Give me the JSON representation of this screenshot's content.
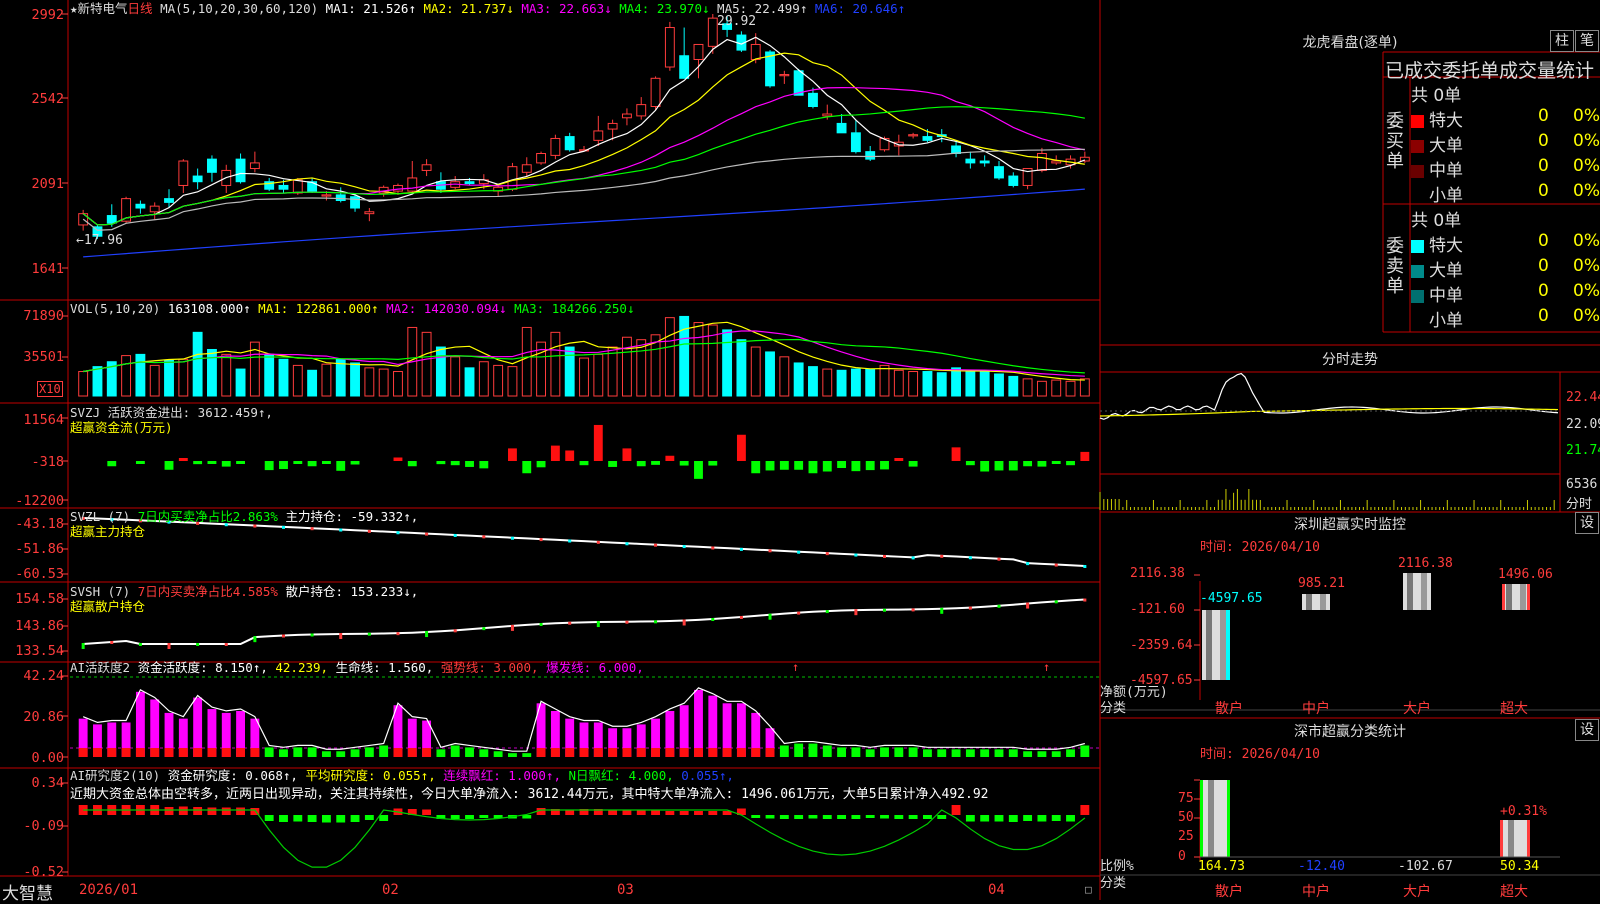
{
  "stock": {
    "star": "★",
    "name": "新特电气",
    "period": "日线",
    "ma_label": "MA(5,10,20,30,60,120)",
    "ma1": "MA1: 21.526↑",
    "ma2": "MA2: 21.737↓",
    "ma3": "MA3: 22.663↓",
    "ma4": "MA4: 23.970↓",
    "ma5": "MA5: 22.499↑",
    "ma6": "MA6: 20.646↑",
    "high_mark": "29.92",
    "low_mark": "←17.96"
  },
  "price_axis": [
    "2992",
    "2542",
    "2091",
    "1641"
  ],
  "vol": {
    "label": "VOL(5,10,20)",
    "value": "163108.000↑",
    "ma1": "MA1: 122861.000↑",
    "ma2": "MA2: 142030.094↓",
    "ma3": "MA3: 184266.250↓",
    "axis": [
      "71890",
      "35501"
    ],
    "unit": "X10"
  },
  "svzj": {
    "label": "SVZJ  活跃资金进出: 3612.459↑,",
    "sub": "超赢资金流(万元)",
    "axis": [
      "11564",
      "-318",
      "-12200"
    ]
  },
  "svzl": {
    "label": "SVZL (7)",
    "buy": "7日内买卖净占比2.863%",
    "hold": "主力持仓: -59.332↑,",
    "sub": "超赢主力持仓",
    "axis": [
      "-43.18",
      "-51.86",
      "-60.53"
    ]
  },
  "svsh": {
    "label": "SVSH (7)",
    "buy": "7日内买卖净占比4.585%",
    "hold": "散户持仓: 153.233↓,",
    "sub": "超赢散户持仓",
    "axis": [
      "154.58",
      "143.86",
      "133.54"
    ]
  },
  "ai1": {
    "label": "AI活跃度2",
    "act": "资金活跃度: 8.150↑,",
    "v": "42.239,",
    "life": "生命线: 1.560,",
    "strong": "强势线: 3.000,",
    "burst": "爆发线: 6.000,",
    "axis": [
      "42.24",
      "20.86",
      "0.00"
    ]
  },
  "ai2": {
    "label": "AI研究度2(10)",
    "res": "资金研究度: 0.068↑,",
    "avg": "平均研究度: 0.055↑,",
    "cont": "连续飘红: 1.000↑,",
    "nday": "N日飘红: 4.000,",
    "last": "0.055↑,",
    "desc": "近期大资金总体由空转多，近两日出现异动，关注其持续性，今日大单净流入: 3612.44万元，其中特大单净流入: 1496.061万元，大单5日累计净入492.92",
    "axis": [
      "0.34",
      "-0.09",
      "-0.52"
    ]
  },
  "dates": [
    "2026/01",
    "02",
    "03",
    "04"
  ],
  "brand": "大智慧",
  "dragon": {
    "title": "龙虎看盘(逐单)",
    "btn1": "柱",
    "btn2": "笔",
    "head": "已成交委托单成交量统计",
    "buy": {
      "label": "委买单",
      "total": "共 0单",
      "rows": [
        {
          "name": "特大",
          "v": "0",
          "p": "0%",
          "color": "#ff0000"
        },
        {
          "name": "大单",
          "v": "0",
          "p": "0%",
          "color": "#8b0000"
        },
        {
          "name": "中单",
          "v": "0",
          "p": "0%",
          "color": "#6a0000"
        },
        {
          "name": "小单",
          "v": "0",
          "p": "0%",
          "color": "#000000"
        }
      ]
    },
    "sell": {
      "label": "委卖单",
      "total": "共 0单",
      "rows": [
        {
          "name": "特大",
          "v": "0",
          "p": "0%",
          "color": "#00ffff"
        },
        {
          "name": "大单",
          "v": "0",
          "p": "0%",
          "color": "#008b8b"
        },
        {
          "name": "中单",
          "v": "0",
          "p": "0%",
          "color": "#007070"
        },
        {
          "name": "小单",
          "v": "0",
          "p": "0%",
          "color": "#000000"
        }
      ]
    }
  },
  "intraday": {
    "title": "分时走势",
    "axis": [
      "22.44",
      "22.09",
      "21.74"
    ],
    "vol": "6536",
    "unit": "分时"
  },
  "sz_monitor": {
    "title": "深圳超赢实时监控",
    "btn": "设",
    "time": "时间: 2026/04/10",
    "axis": [
      "2116.38",
      "-121.60",
      "-2359.64",
      "-4597.65"
    ],
    "ylabel": "净额(万元)",
    "xlabel": "分类",
    "cats": [
      "散户",
      "中户",
      "大户",
      "超大"
    ],
    "vals": [
      "-4597.65",
      "985.21",
      "2116.38",
      "1496.06"
    ]
  },
  "sz_class": {
    "title": "深市超赢分类统计",
    "btn": "设",
    "time": "时间: 2026/04/10",
    "axis": [
      "75",
      "50",
      "25",
      "0"
    ],
    "ylabel": "比例%",
    "xlabel": "分类",
    "cats": [
      "散户",
      "中户",
      "大户",
      "超大"
    ],
    "vals": [
      "164.73",
      "-12.40",
      "-102.67",
      "50.34"
    ],
    "top": "+0.31%"
  },
  "chart_data": [
    {
      "type": "candlestick",
      "title": "新特电气 日线",
      "note": "daily OHLC (approximate read from chart)",
      "ohlc": [
        [
          18.7,
          19.5,
          18.4,
          19.3
        ],
        [
          18.6,
          18.7,
          17.96,
          18.1
        ],
        [
          19.2,
          19.8,
          18.6,
          18.8
        ],
        [
          18.9,
          20.2,
          18.8,
          20.1
        ],
        [
          19.8,
          20.0,
          19.3,
          19.6
        ],
        [
          19.4,
          19.9,
          19.0,
          19.7
        ],
        [
          20.1,
          20.6,
          19.6,
          19.9
        ],
        [
          20.8,
          22.2,
          20.4,
          22.1
        ],
        [
          21.3,
          21.7,
          20.6,
          21.0
        ],
        [
          22.2,
          22.4,
          21.0,
          21.5
        ],
        [
          20.8,
          21.9,
          20.4,
          21.6
        ],
        [
          22.2,
          22.5,
          20.9,
          21.0
        ],
        [
          21.7,
          22.6,
          21.5,
          22.0
        ],
        [
          21.0,
          21.2,
          20.5,
          20.6
        ],
        [
          20.8,
          21.1,
          20.4,
          20.6
        ],
        [
          20.4,
          21.2,
          20.3,
          21.1
        ],
        [
          21.0,
          21.2,
          20.4,
          20.5
        ],
        [
          20.3,
          20.5,
          20.0,
          20.3
        ],
        [
          20.3,
          20.7,
          19.9,
          20.0
        ],
        [
          20.2,
          20.4,
          19.4,
          19.6
        ],
        [
          19.3,
          19.6,
          18.9,
          19.4
        ],
        [
          20.4,
          20.8,
          20.2,
          20.7
        ],
        [
          20.5,
          20.9,
          20.3,
          20.8
        ],
        [
          20.5,
          22.1,
          20.4,
          21.2
        ],
        [
          21.6,
          22.2,
          21.3,
          21.9
        ],
        [
          21.0,
          21.5,
          20.4,
          20.6
        ],
        [
          20.7,
          21.3,
          20.6,
          21.0
        ],
        [
          21.0,
          21.2,
          20.8,
          20.9
        ],
        [
          20.9,
          21.4,
          20.6,
          21.1
        ],
        [
          20.5,
          20.9,
          20.2,
          20.7
        ],
        [
          20.6,
          22.0,
          20.5,
          21.8
        ],
        [
          21.5,
          22.3,
          21.3,
          21.9
        ],
        [
          22.0,
          22.6,
          21.9,
          22.5
        ],
        [
          22.4,
          23.5,
          22.2,
          23.3
        ],
        [
          23.4,
          23.6,
          22.6,
          22.7
        ],
        [
          22.7,
          22.9,
          22.6,
          22.7
        ],
        [
          23.2,
          24.5,
          22.9,
          23.7
        ],
        [
          23.8,
          24.3,
          23.2,
          24.1
        ],
        [
          24.4,
          24.9,
          24.0,
          24.6
        ],
        [
          24.5,
          25.5,
          24.3,
          25.1
        ],
        [
          25.0,
          26.6,
          24.8,
          26.5
        ],
        [
          27.1,
          29.5,
          26.9,
          29.2
        ],
        [
          27.7,
          29.2,
          27.3,
          26.5
        ],
        [
          27.5,
          28.3,
          26.5,
          28.3
        ],
        [
          28.2,
          29.92,
          27.8,
          29.7
        ],
        [
          29.4,
          29.8,
          28.7,
          29.1
        ],
        [
          28.8,
          29.0,
          27.9,
          28.0
        ],
        [
          27.5,
          28.9,
          27.3,
          28.3
        ],
        [
          27.9,
          28.0,
          26.0,
          26.1
        ],
        [
          26.7,
          26.9,
          26.2,
          26.7
        ],
        [
          26.9,
          27.0,
          25.8,
          25.6
        ],
        [
          25.7,
          26.0,
          24.9,
          25.0
        ],
        [
          24.5,
          25.1,
          24.3,
          24.6
        ],
        [
          24.1,
          24.6,
          23.6,
          23.6
        ],
        [
          23.6,
          24.3,
          22.5,
          22.6
        ],
        [
          22.6,
          22.9,
          22.1,
          22.2
        ],
        [
          22.7,
          23.4,
          22.6,
          23.3
        ],
        [
          22.9,
          23.5,
          22.4,
          23.1
        ],
        [
          23.5,
          23.6,
          23.3,
          23.5
        ],
        [
          23.4,
          23.8,
          23.1,
          23.2
        ],
        [
          23.5,
          23.8,
          23.1,
          23.4
        ],
        [
          22.9,
          23.2,
          22.3,
          22.5
        ],
        [
          22.2,
          22.6,
          21.7,
          22.0
        ],
        [
          22.1,
          22.4,
          21.8,
          22.0
        ],
        [
          21.8,
          22.1,
          21.1,
          21.2
        ],
        [
          21.3,
          21.5,
          20.7,
          20.8
        ],
        [
          20.8,
          21.7,
          20.6,
          21.7
        ],
        [
          21.6,
          22.8,
          21.5,
          22.5
        ],
        [
          22.0,
          22.4,
          21.9,
          22.1
        ],
        [
          21.9,
          22.4,
          21.7,
          22.2
        ],
        [
          22.1,
          22.6,
          22.0,
          22.3
        ]
      ],
      "ma_series": [
        "MA1",
        "MA2",
        "MA3",
        "MA4",
        "MA5",
        "MA6"
      ],
      "ylim": [
        16.41,
        29.92
      ]
    },
    {
      "type": "bar",
      "title": "VOL(5,10,20)",
      "unit": "X10",
      "ylim": [
        0,
        71890
      ]
    },
    {
      "type": "bar",
      "title": "SVZJ 活跃资金进出",
      "unit": "万元",
      "ylim": [
        -12200,
        11564
      ]
    },
    {
      "type": "bar",
      "title": "深圳超赢实时监控",
      "categories": [
        "散户",
        "中户",
        "大户",
        "超大"
      ],
      "values": [
        -4597.65,
        985.21,
        2116.38,
        1496.06
      ]
    },
    {
      "type": "bar",
      "title": "深市超赢分类统计",
      "categories": [
        "散户",
        "中户",
        "大户",
        "超大"
      ],
      "values": [
        164.73,
        -12.4,
        -102.67,
        50.34
      ],
      "ylim": [
        0,
        75
      ]
    }
  ]
}
